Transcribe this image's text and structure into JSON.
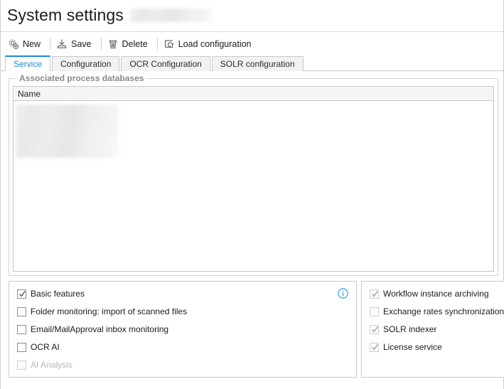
{
  "header": {
    "title": "System settings",
    "redacted_suffix": true
  },
  "toolbar": {
    "items": [
      {
        "label": "New",
        "icon": "gear-plus-icon"
      },
      {
        "label": "Save",
        "icon": "save-icon"
      },
      {
        "label": "Delete",
        "icon": "trash-icon"
      },
      {
        "label": "Load configuration",
        "icon": "load-configuration-icon"
      }
    ]
  },
  "tabs": [
    {
      "label": "Service",
      "active": true
    },
    {
      "label": "Configuration",
      "active": false
    },
    {
      "label": "OCR Configuration",
      "active": false
    },
    {
      "label": "SOLR configuration",
      "active": false
    }
  ],
  "groupbox": {
    "title": "Associated process databases",
    "grid": {
      "columns": [
        "Name"
      ],
      "rows": [],
      "redacted_rows": true
    }
  },
  "panels": {
    "left": {
      "info_icon": "info-icon",
      "checkboxes": [
        {
          "label": "Basic features",
          "checked": true,
          "enabled": true
        },
        {
          "label": "Folder monitoring: import of scanned files",
          "checked": false,
          "enabled": true
        },
        {
          "label": "Email/MailApproval inbox monitoring",
          "checked": false,
          "enabled": true
        },
        {
          "label": "OCR AI",
          "checked": false,
          "enabled": true
        },
        {
          "label": "AI Analysis",
          "checked": false,
          "enabled": false
        }
      ]
    },
    "right": {
      "checkboxes": [
        {
          "label": "Workflow instance archiving",
          "checked": true,
          "enabled": false
        },
        {
          "label": "Exchange rates synchronization",
          "checked": false,
          "enabled": false
        },
        {
          "label": "SOLR indexer",
          "checked": true,
          "enabled": false
        },
        {
          "label": "License service",
          "checked": true,
          "enabled": false
        }
      ]
    }
  },
  "colors": {
    "accent": "#1e8bd4",
    "info": "#29a7e1",
    "text": "#1b1b1b",
    "muted": "#8a8a8a",
    "border": "#c8c8c8"
  }
}
